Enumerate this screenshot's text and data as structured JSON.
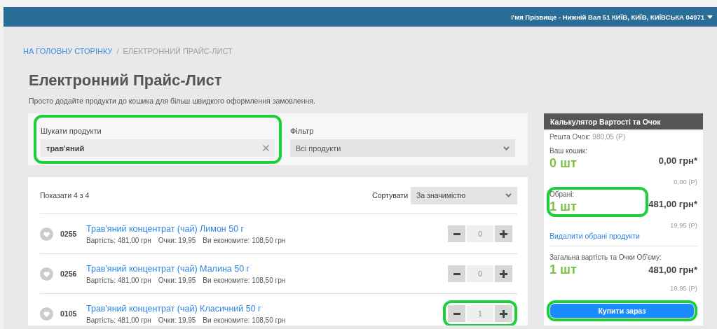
{
  "header": {
    "user_address": "І'мя Прізвище - Нижній Вал 51 КИЇВ, КИЇВ, КИЇВСЬКА 04071"
  },
  "breadcrumb": [
    {
      "label": "НА ГОЛОВНУ СТОРІНКУ",
      "kind": "link"
    },
    {
      "label": "/",
      "kind": "separator"
    },
    {
      "label": "ЕЛЕКТРОННИЙ ПРАЙС-ЛИСТ",
      "kind": "current"
    }
  ],
  "title": "Електронний Прайс-Лист",
  "subtitle": "Просто додайте продукти до кошика для більш швидкого оформлення замовлення.",
  "search": {
    "label": "Шукати продукти",
    "value": "трав'яний",
    "highlighted": true
  },
  "filter": {
    "label": "Фільтр",
    "value": "Всі продукти"
  },
  "results": {
    "count": "Показати 4 з 4",
    "sort_label": "Сортувати",
    "sort_value": "За значимістю"
  },
  "products": [
    {
      "code": "0255",
      "name": "Трав'яний концентрат (чай) Лимон 50 г",
      "price": "Вартість: 481,00 грн",
      "points": "Очки: 19,95",
      "savings": "Ви економите: 108,50 грн",
      "quantity": "0",
      "highlighted": false
    },
    {
      "code": "0256",
      "name": "Трав'яний концентрат (чай) Малина 50 г",
      "price": "Вартість: 481,00 грн",
      "points": "Очки: 19,95",
      "savings": "Ви економите: 108,50 грн",
      "quantity": "0",
      "highlighted": false
    },
    {
      "code": "0105",
      "name": "Трав'яний концентрат (чай) Класичний 50 г",
      "price": "Вартість: 481,00 грн",
      "points": "Очки: 19,95",
      "savings": "Ви економите: 108,50 грн",
      "quantity": "1",
      "highlighted": true
    }
  ],
  "calculator": {
    "title": "Калькулятор Вартості та Очок",
    "balance_label": "Решта Очок:",
    "balance_value": "980,05 (Р)",
    "sections": [
      {
        "label": "Ваш кошик:",
        "count": "0 шт",
        "price": "0,00 грн*",
        "points": "0,00 (Р)",
        "highlighted": false
      },
      {
        "label": "Обрані:",
        "count": "1 шт",
        "price": "481,00 грн*",
        "points": "19,95 (Р)",
        "highlighted": true,
        "link": "Видалити обрані продукти"
      },
      {
        "label": "Загальна вартість та Очки Об'єму:",
        "count": "1 шт",
        "price": "481,00 грн*",
        "points": "19,95 (Р)",
        "highlighted": false
      }
    ],
    "buy_button": {
      "label": "Купити зараз",
      "highlighted": true
    }
  }
}
